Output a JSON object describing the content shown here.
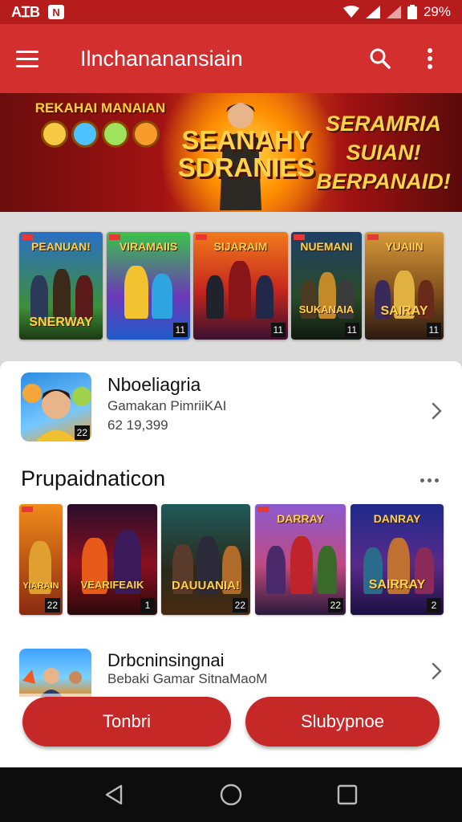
{
  "status_bar": {
    "carrier": "AꞮB",
    "notification_badge": "N",
    "battery": "29%"
  },
  "app_bar": {
    "title": "Ilnchananansiain"
  },
  "hero": {
    "left_text": "REKAHAI MANAIAN",
    "center_text": "SEANAHY SDRANIES",
    "right_text": "SERAMRIA SUIAN! BERPANAID!"
  },
  "posters": [
    {
      "title": "PEANUAN!",
      "bottom": "SNERWAY",
      "num": ""
    },
    {
      "title": "VIRAMAIIS",
      "bottom": "",
      "num": "11"
    },
    {
      "title": "SIJARAIM",
      "bottom": "",
      "num": "11"
    },
    {
      "title": "NUEMANI",
      "bottom": "SUKANAIA",
      "num": "11"
    },
    {
      "title": "YUAIIN",
      "bottom": "SAIRAY",
      "num": "11"
    }
  ],
  "featured_app": {
    "name": "Nboeliagria",
    "subtitle": "Gamakan PimriiKAI",
    "count": "62 19,399",
    "badge": "22"
  },
  "section": {
    "title": "Prupaidnaticon"
  },
  "tiles": [
    {
      "title": "",
      "bottom": "YIARAIN",
      "num": "22"
    },
    {
      "title": "",
      "bottom": "VEARIFEAIK",
      "num": "1"
    },
    {
      "title": "",
      "bottom": "DAUUANIA!",
      "num": "22"
    },
    {
      "title": "DARRAY",
      "bottom": "",
      "num": "22"
    },
    {
      "title": "DANRAY",
      "bottom": "SAIRRAY",
      "num": "2"
    }
  ],
  "second_app": {
    "name": "Drbcninsingnai",
    "subtitle": "Bebaki Gamar SitnaMaoM"
  },
  "buttons": {
    "left": "Tonbri",
    "right": "Slubypnoe"
  },
  "colors": {
    "primary": "#d32f2f",
    "status": "#b71c1c",
    "accent_gold": "#ffd34a"
  },
  "icons": [
    "menu-icon",
    "search-icon",
    "overflow-menu-icon",
    "chevron-right-icon",
    "more-icon",
    "back-icon",
    "home-icon",
    "recents-icon"
  ]
}
